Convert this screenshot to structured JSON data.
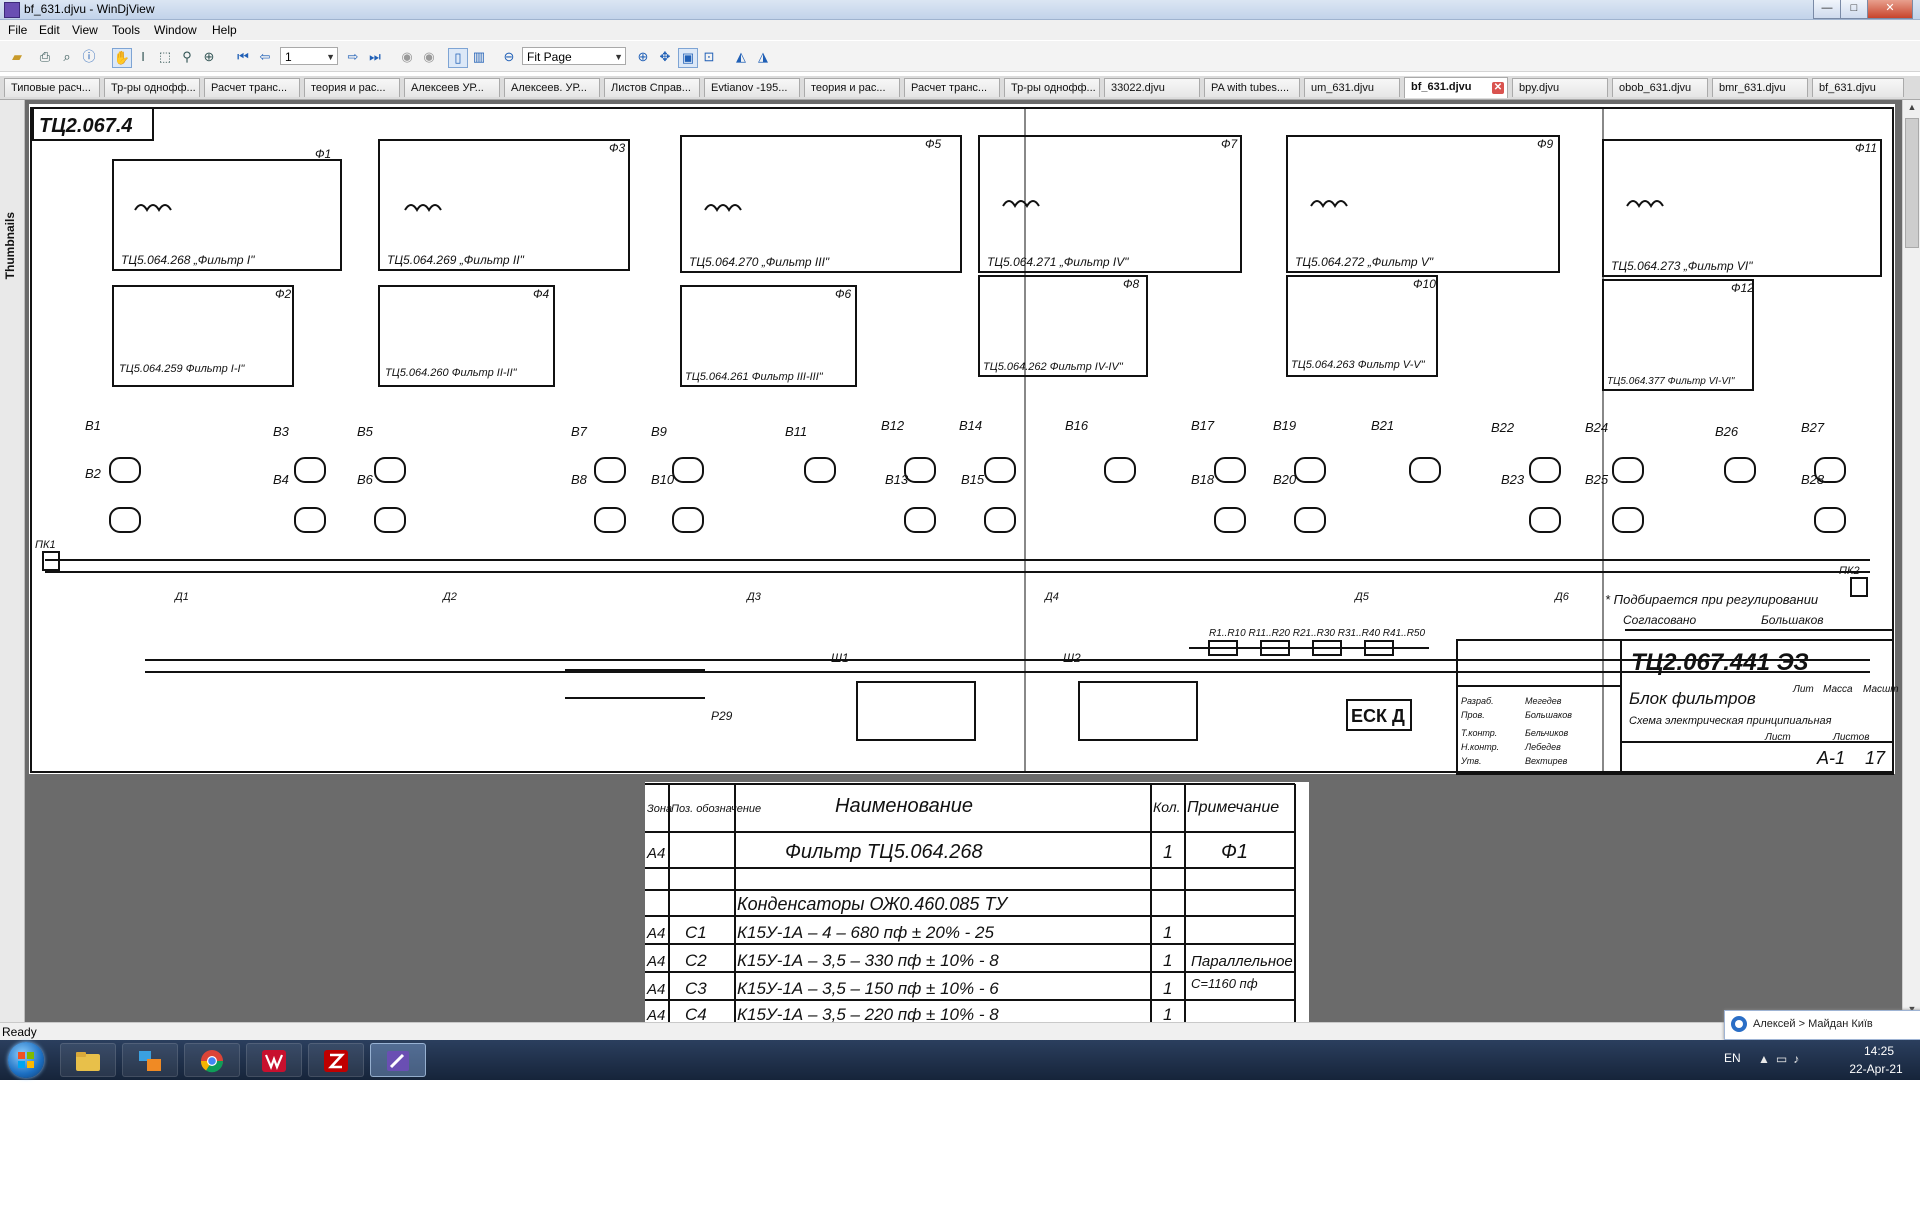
{
  "window": {
    "title": "bf_631.djvu - WinDjView",
    "minimize": "—",
    "maximize": "□",
    "close": "✕"
  },
  "menu": [
    "File",
    "Edit",
    "View",
    "Tools",
    "Window",
    "Help"
  ],
  "toolbar": {
    "page_number": "1",
    "zoom": "Fit Page"
  },
  "tabs": [
    {
      "label": "Типовые расч...",
      "active": false
    },
    {
      "label": "Тр-ры однофф...",
      "active": false
    },
    {
      "label": "Расчет транс...",
      "active": false
    },
    {
      "label": "теория и рас...",
      "active": false
    },
    {
      "label": "Алексеев УР...",
      "active": false
    },
    {
      "label": "Алексеев. УР...",
      "active": false
    },
    {
      "label": "Листов Справ...",
      "active": false
    },
    {
      "label": "Evtianov -195...",
      "active": false
    },
    {
      "label": "теория и рас...",
      "active": false
    },
    {
      "label": "Расчет транс...",
      "active": false
    },
    {
      "label": "Тр-ры однофф...",
      "active": false
    },
    {
      "label": "33022.djvu",
      "active": false
    },
    {
      "label": "PA with tubes....",
      "active": false
    },
    {
      "label": "um_631.djvu",
      "active": false
    },
    {
      "label": "bf_631.djvu",
      "active": true
    },
    {
      "label": "bpy.djvu",
      "active": false
    },
    {
      "label": "obob_631.djvu",
      "active": false
    },
    {
      "label": "bmr_631.djvu",
      "active": false
    },
    {
      "label": "bf_631.djvu",
      "active": false
    }
  ],
  "sidebar": {
    "thumbnails_label": "Thumbnails"
  },
  "drawing": {
    "doc_number_corner": "ТЦ2.067.4",
    "doc_code": "ТЦ2.067.441 ЭЗ",
    "block_title": "Блок фильтров",
    "subtitle": "Схема электрическая принципиальная",
    "note": "* Подбирается при регулировании",
    "stamp": "ЕСК Д",
    "approved": "Согласовано",
    "approved_by": "Большаков",
    "sheet": "А-1",
    "sheet_num": "17",
    "lit": "Лит",
    "mass": "Масса",
    "scale": "Масшт",
    "list": "Лист",
    "lists": "Листов",
    "roles": [
      "Разраб.",
      "Пров.",
      "Т.контр.",
      "Н.контр.",
      "Утв."
    ],
    "names": [
      "Мегедев",
      "Большаков",
      "Бельчиков",
      "Лебедев",
      "Вехтирев"
    ],
    "filters": [
      {
        "label": "Ф1",
        "name": "ТЦ5.064.268 „Фильтр I\""
      },
      {
        "label": "Ф3",
        "name": "ТЦ5.064.269 „Фильтр II\""
      },
      {
        "label": "Ф5",
        "name": "ТЦ5.064.270 „Фильтр III\""
      },
      {
        "label": "Ф7",
        "name": "ТЦ5.064.271 „Фильтр IV\""
      },
      {
        "label": "Ф9",
        "name": "ТЦ5.064.272 „Фильтр V\""
      },
      {
        "label": "Ф11",
        "name": "ТЦ5.064.273 „Фильтр VI\""
      }
    ],
    "subfilters": [
      {
        "label": "Ф2",
        "name": "ТЦ5.064.259 Фильтр I-I\""
      },
      {
        "label": "Ф4",
        "name": "ТЦ5.064.260 Фильтр II-II\""
      },
      {
        "label": "Ф6",
        "name": "ТЦ5.064.261 Фильтр III-III\""
      },
      {
        "label": "Ф8",
        "name": "ТЦ5.064.262 Фильтр IV-IV\""
      },
      {
        "label": "Ф10",
        "name": "ТЦ5.064.263 Фильтр V-V\""
      },
      {
        "label": "Ф12",
        "name": "ТЦ5.064.377 Фильтр VI-VI\""
      }
    ],
    "switches_top": [
      "В1",
      "В3",
      "В5",
      "В7",
      "В9",
      "В11",
      "В12",
      "В14",
      "В16",
      "В17",
      "В19",
      "В21",
      "В22",
      "В24",
      "В26",
      "В27"
    ],
    "switches_bottom": [
      "В2",
      "В4",
      "В6",
      "В8",
      "В10",
      "В13",
      "В15",
      "В18",
      "В20",
      "В23",
      "В25",
      "В28"
    ],
    "connectors": [
      "ПК1",
      "ПК2",
      "Ш1",
      "Ш2",
      "Р29"
    ],
    "bus_labels": [
      "Д1",
      "Д2",
      "Д3",
      "Д4",
      "Д5",
      "Д6"
    ],
    "resistor_chain": "R1..R10 R11..R20 R21..R30 R31..R40 R41..R50"
  },
  "bom": {
    "headers": [
      "Зона",
      "Поз. обозначение",
      "Наименование",
      "Кол.",
      "Примечание"
    ],
    "rows": [
      {
        "zone": "А4",
        "pos": "",
        "name": "Фильтр   ТЦ5.064.268",
        "qty": "1",
        "note": "Ф1"
      },
      {
        "zone": "",
        "pos": "",
        "name": "",
        "qty": "",
        "note": ""
      },
      {
        "zone": "",
        "pos": "",
        "name": "Конденсаторы   ОЖ0.460.085 ТУ",
        "qty": "",
        "note": ""
      },
      {
        "zone": "А4",
        "pos": "С1",
        "name": "К15У-1А – 4 – 680 пф ± 20% - 25",
        "qty": "1",
        "note": ""
      },
      {
        "zone": "А4",
        "pos": "С2",
        "name": "К15У-1А – 3,5 – 330 пф ± 10% - 8",
        "qty": "1",
        "note": "Параллельное"
      },
      {
        "zone": "А4",
        "pos": "С3",
        "name": "К15У-1А – 3,5 – 150 пф ± 10% - 6",
        "qty": "1",
        "note": "С=1160 пф"
      },
      {
        "zone": "А4",
        "pos": "С4",
        "name": "К15У-1А – 3,5 – 220 пф ± 10% - 8",
        "qty": "1",
        "note": ""
      }
    ]
  },
  "status": {
    "text": "Ready"
  },
  "notification": {
    "text": "Алексей > Майдан Київ"
  },
  "taskbar": {
    "lang": "EN",
    "time": "14:25",
    "date": "22-Apr-21"
  }
}
